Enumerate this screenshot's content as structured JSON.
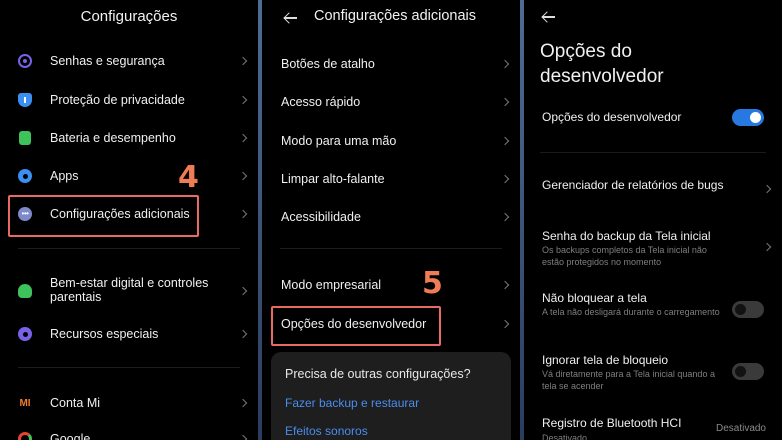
{
  "panel1": {
    "title": "Configurações",
    "items": [
      {
        "label": "Senhas e segurança"
      },
      {
        "label": "Proteção de privacidade"
      },
      {
        "label": "Bateria e desempenho"
      },
      {
        "label": "Apps"
      },
      {
        "label": "Configurações adicionais"
      },
      {
        "label": "Bem-estar digital e controles parentais"
      },
      {
        "label": "Recursos especiais"
      },
      {
        "label": "Conta Mi"
      },
      {
        "label": "Google"
      }
    ],
    "annotation": "4"
  },
  "panel2": {
    "title": "Configurações adicionais",
    "items": [
      {
        "label": "Botões de atalho"
      },
      {
        "label": "Acesso rápido"
      },
      {
        "label": "Modo para uma mão"
      },
      {
        "label": "Limpar alto-falante"
      },
      {
        "label": "Acessibilidade"
      },
      {
        "label": "Modo empresarial"
      },
      {
        "label": "Opções do desenvolvedor"
      }
    ],
    "annotation": "5",
    "card": {
      "question": "Precisa de outras configurações?",
      "links": [
        "Fazer backup e restaurar",
        "Efeitos sonoros"
      ]
    }
  },
  "panel3": {
    "title_line1": "Opções do",
    "title_line2": "desenvolvedor",
    "master_toggle": {
      "label": "Opções do desenvolvedor",
      "on": true
    },
    "rows": [
      {
        "label": "Gerenciador de relatórios de bugs",
        "sub": ""
      },
      {
        "label": "Senha do backup da Tela inicial",
        "sub": "Os backups completos da Tela inicial não estão protegidos no momento"
      },
      {
        "label": "Não bloquear a tela",
        "sub": "A tela não desligará durante o carregamento",
        "on": false
      },
      {
        "label": "Ignorar tela de bloqueio",
        "sub": "Vá diretamente para a Tela inicial quando a tela se acender",
        "on": false
      },
      {
        "label": "Registro de Bluetooth HCI",
        "sub": "Desativado",
        "value": "Desativado"
      }
    ]
  },
  "colors": {
    "accent": "#2778e0",
    "annotation": "#e86a62",
    "link": "#4a8df0"
  }
}
